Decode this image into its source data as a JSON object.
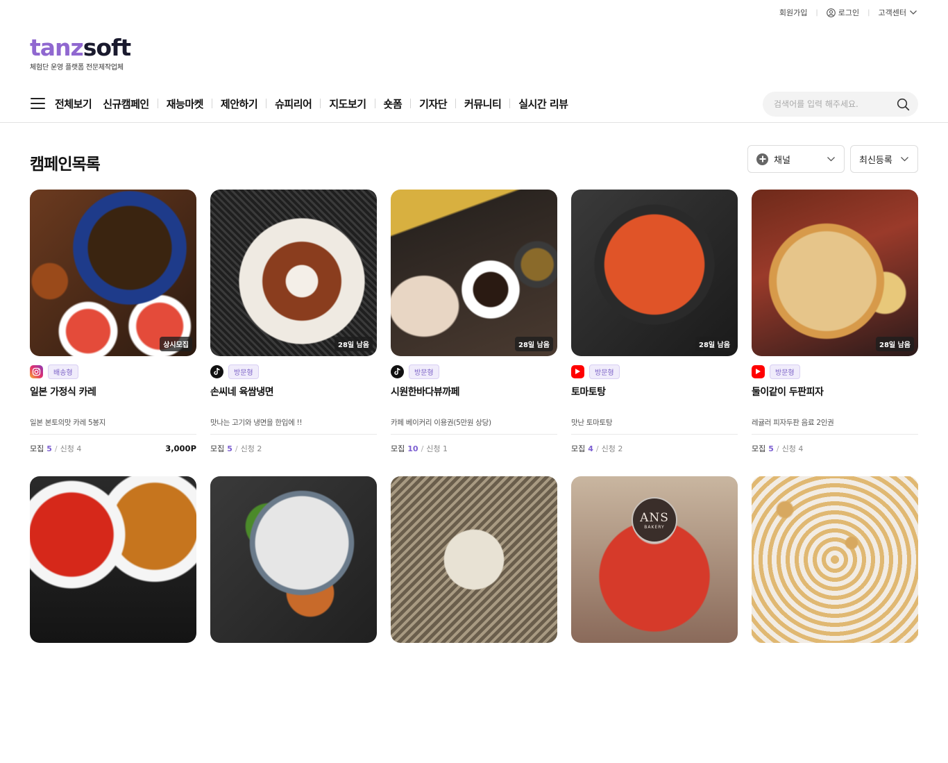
{
  "topbar": {
    "signup": "회원가입",
    "login": "로그인",
    "support": "고객센터"
  },
  "logo": {
    "part1": "tanz",
    "part2": "soft",
    "tagline": "체험단 운영 플랫폼 전문제작업체"
  },
  "nav": {
    "items": [
      "전체보기",
      "신규캠페인",
      "재능마켓",
      "제안하기",
      "슈피리어",
      "지도보기",
      "숏폼",
      "기자단",
      "커뮤니티",
      "실시간 리뷰"
    ]
  },
  "search": {
    "placeholder": "검색어를 입력 해주세요."
  },
  "page": {
    "title": "캠페인목록",
    "channel_filter": "채널",
    "sort_filter": "최신등록"
  },
  "labels": {
    "recruit": "모집",
    "apply": "신청"
  },
  "campaigns": [
    {
      "channel": "instagram-icon",
      "type": "배송형",
      "title": "일본 가정식 카레",
      "desc": "일본 본토의맛 카레 5봉지",
      "badge": "상시모집",
      "recruit": "5",
      "apply": "신청 4",
      "point": "3,000P"
    },
    {
      "channel": "tiktok-icon",
      "type": "방문형",
      "title": "손씨네 육쌈냉면",
      "desc": "맛나는 고기와 냉면을 한입에 !!",
      "badge": "28일 남음",
      "recruit": "5",
      "apply": "신청 2",
      "point": ""
    },
    {
      "channel": "tiktok-icon",
      "type": "방문형",
      "title": "시원한바다뷰까페",
      "desc": "카페 베이커리 이용권(5만원 상당)",
      "badge": "28일 남음",
      "recruit": "10",
      "apply": "신청 1",
      "point": ""
    },
    {
      "channel": "youtube-icon",
      "type": "방문형",
      "title": "토마토탕",
      "desc": "맛난 토마토탕",
      "badge": "28일 남음",
      "recruit": "4",
      "apply": "신청 2",
      "point": ""
    },
    {
      "channel": "youtube-icon",
      "type": "방문형",
      "title": "둘이같이 두판피자",
      "desc": "레귤러 피자두판 음료 2인권",
      "badge": "28일 남음",
      "recruit": "5",
      "apply": "신청 4",
      "point": ""
    }
  ],
  "second_row_logo": {
    "brand": "ANS",
    "sub": "BAKERY"
  },
  "colors": {
    "brand_purple": "#9068d0",
    "accent": "#7c5fd1"
  }
}
